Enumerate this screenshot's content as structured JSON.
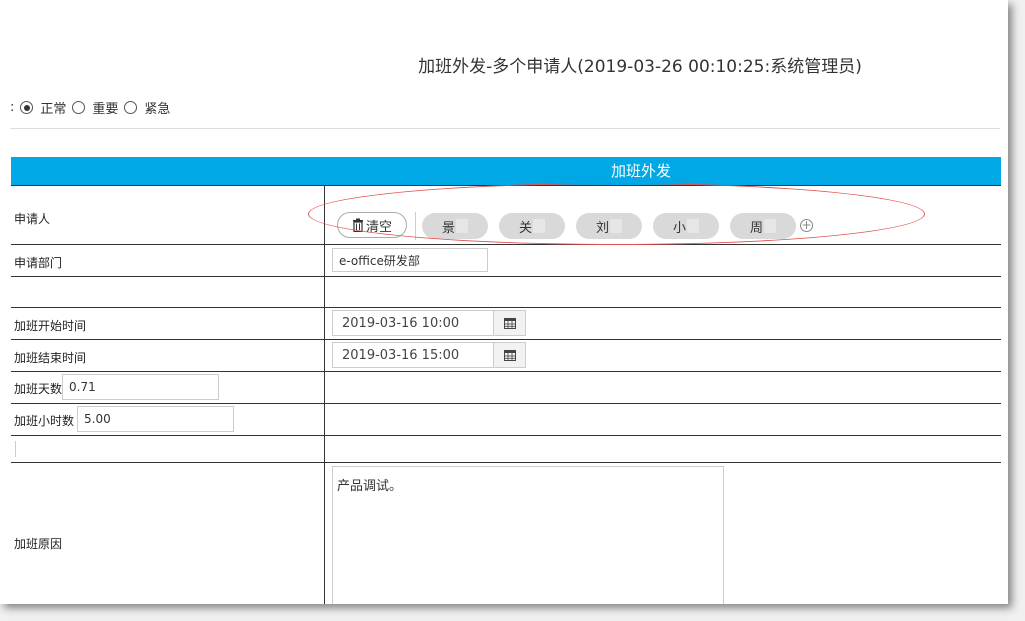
{
  "title": "加班外发-多个申请人(2019-03-26 00:10:25:系统管理员)",
  "priority": {
    "prefix": ":",
    "options": [
      "正常",
      "重要",
      "紧急"
    ],
    "selected": "正常"
  },
  "form": {
    "header": "加班外发",
    "applicant": {
      "label": "申请人",
      "clear_label": "清空",
      "chips": [
        "景",
        "关",
        "刘",
        "小",
        "周"
      ]
    },
    "department": {
      "label": "申请部门",
      "value": "e-office研发部"
    },
    "start_time": {
      "label": "加班开始时间",
      "value": "2019-03-16 10:00"
    },
    "end_time": {
      "label": "加班结束时间",
      "value": "2019-03-16 15:00"
    },
    "days": {
      "label": "加班天数",
      "value": "0.71"
    },
    "hours": {
      "label": "加班小时数",
      "value": "5.00"
    },
    "reason": {
      "label": "加班原因",
      "value": "产品调试。"
    }
  },
  "colors": {
    "header_bg": "#00a8e6",
    "annotation": "#e05050"
  }
}
